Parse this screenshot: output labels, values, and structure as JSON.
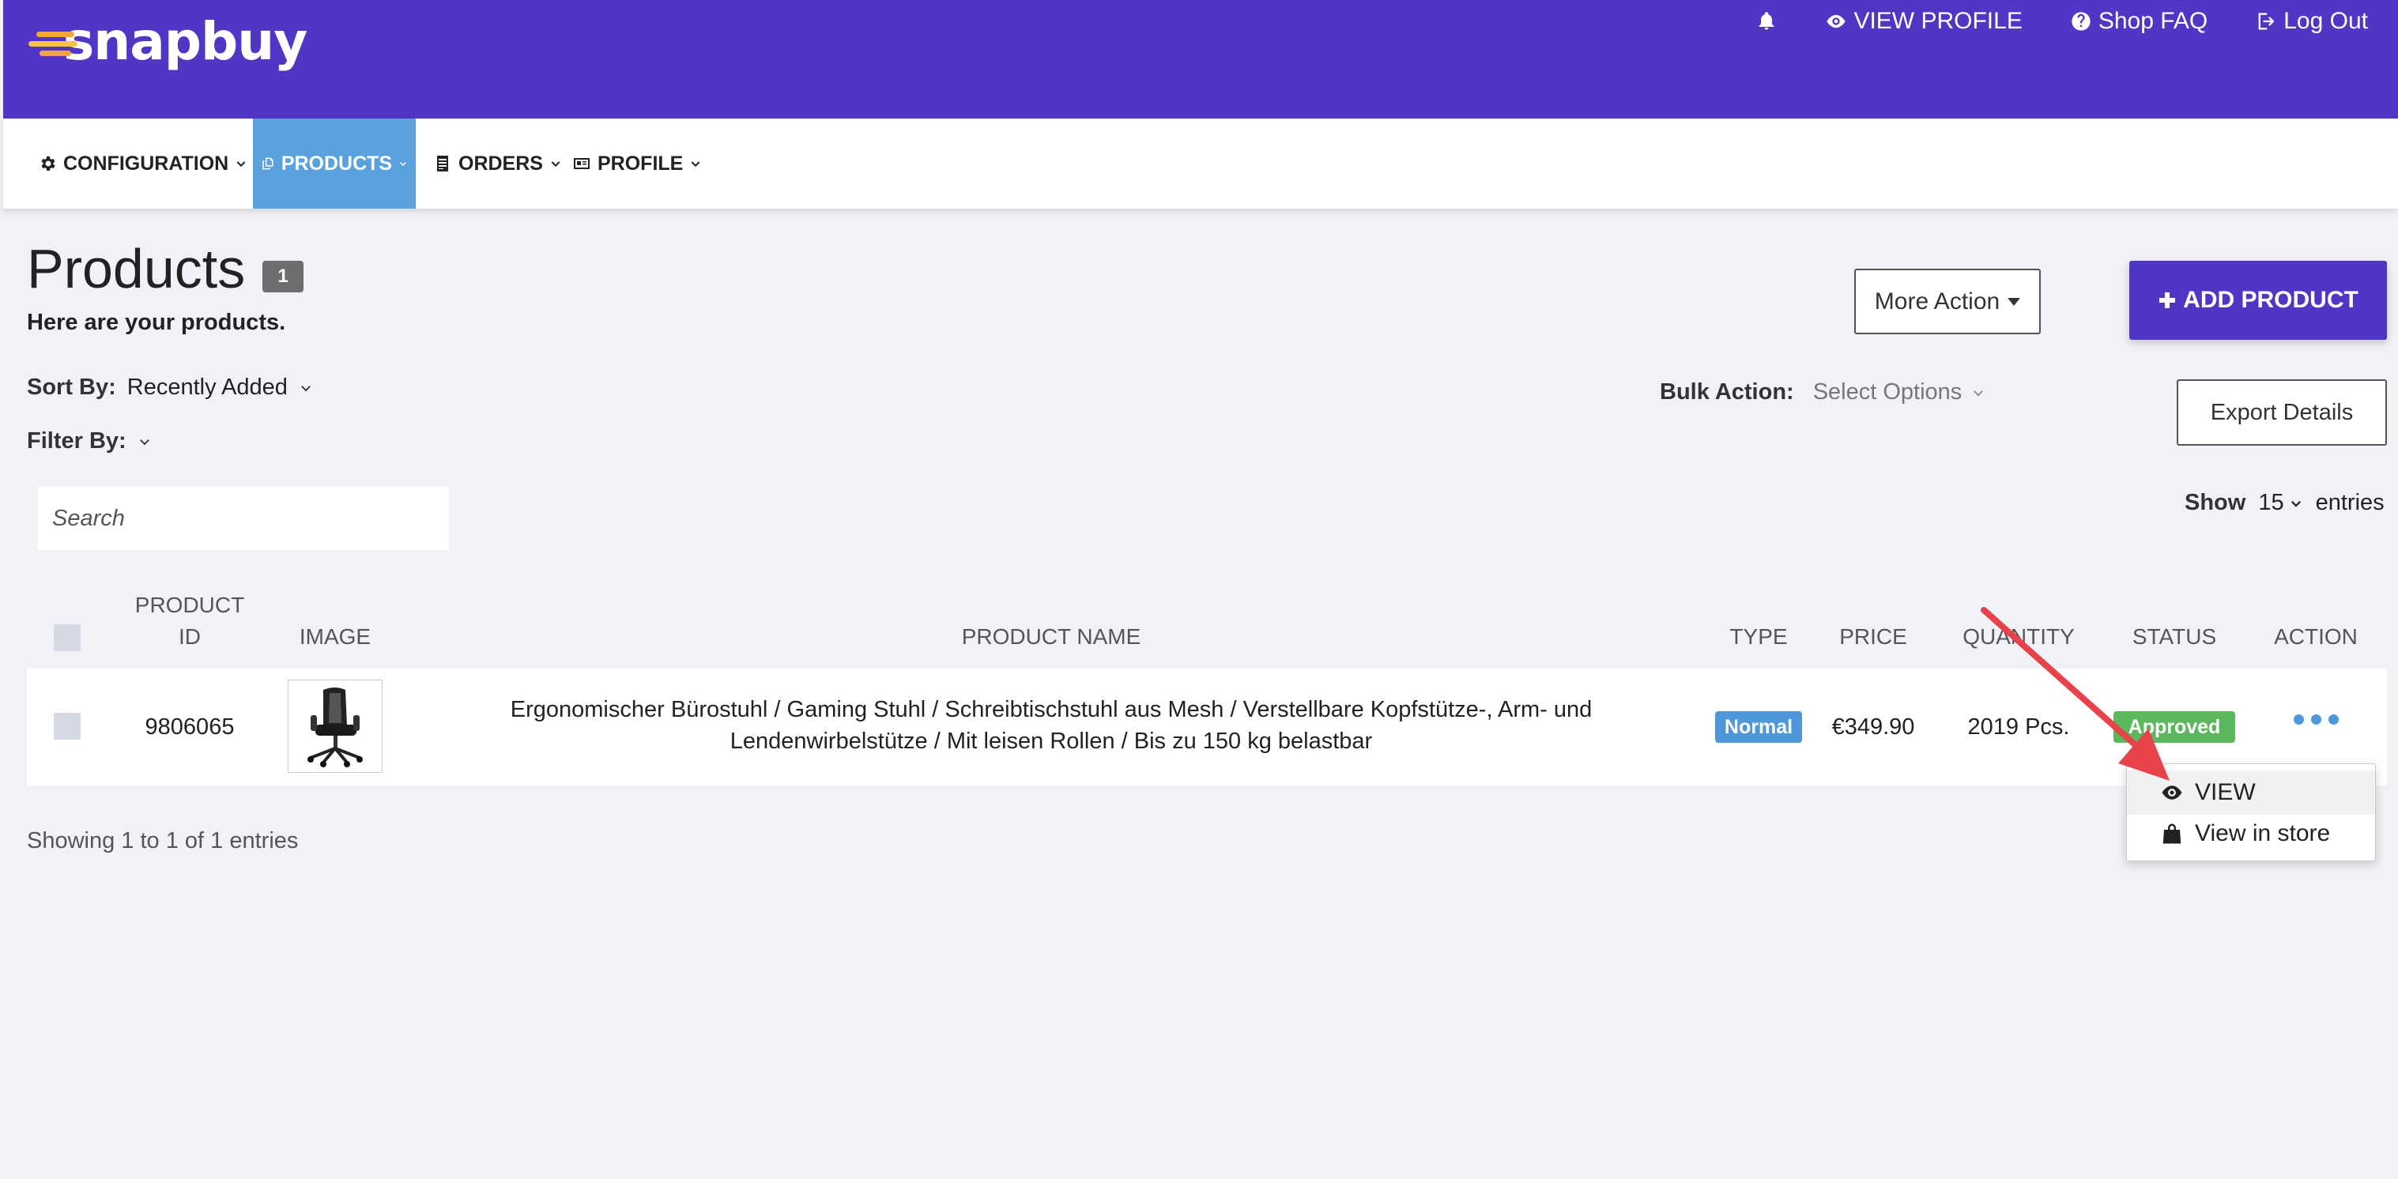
{
  "app": {
    "brand": "snapbuy",
    "brand_color": "#5136c6",
    "accent_blue": "#4e97db"
  },
  "header": {
    "notifications_icon": "bell-icon",
    "links": [
      {
        "label": "VIEW PROFILE",
        "icon": "eye-icon"
      },
      {
        "label": "Shop FAQ",
        "icon": "question-circle-icon"
      },
      {
        "label": "Log Out",
        "icon": "sign-out-icon"
      }
    ]
  },
  "nav": {
    "items": [
      {
        "label": "CONFIGURATION",
        "icon": "gear-icon"
      },
      {
        "label": "PRODUCTS",
        "icon": "copy-icon",
        "active": true
      },
      {
        "label": "ORDERS",
        "icon": "list-icon"
      },
      {
        "label": "PROFILE",
        "icon": "id-card-icon"
      }
    ]
  },
  "page": {
    "title": "Products",
    "count": "1",
    "subtitle": "Here are your products.",
    "more_action_label": "More Action",
    "add_product_label": "ADD PRODUCT",
    "export_label": "Export Details"
  },
  "controls": {
    "sort_label": "Sort By:",
    "sort_value": "Recently Added",
    "filter_label": "Filter By:",
    "bulk_label": "Bulk Action:",
    "bulk_value": "Select Options",
    "search_placeholder": "Search",
    "show_label": "Show",
    "show_value": "15",
    "entries_label": "entries"
  },
  "table": {
    "headers": {
      "product_id_1": "PRODUCT",
      "product_id_2": "ID",
      "image": "IMAGE",
      "product_name": "PRODUCT NAME",
      "type": "TYPE",
      "price": "PRICE",
      "quantity": "QUANTITY",
      "status": "STATUS",
      "action": "ACTION"
    },
    "rows": [
      {
        "product_id": "9806065",
        "image_icon": "office-chair-thumbnail",
        "product_name": "Ergonomischer Bürostuhl / Gaming Stuhl / Schreibtischstuhl aus Mesh / Verstellbare Kopfstütze-, Arm- und Lendenwirbelstütze / Mit leisen Rollen / Bis zu 150 kg belastbar",
        "type": "Normal",
        "price": "€349.90",
        "quantity": "2019 Pcs.",
        "status": "Approved"
      }
    ],
    "footer": "Showing 1 to 1 of 1 entries"
  },
  "action_menu": {
    "items": [
      {
        "label": "VIEW",
        "icon": "eye-icon"
      },
      {
        "label": "View in store",
        "icon": "shopping-bag-icon"
      }
    ]
  }
}
